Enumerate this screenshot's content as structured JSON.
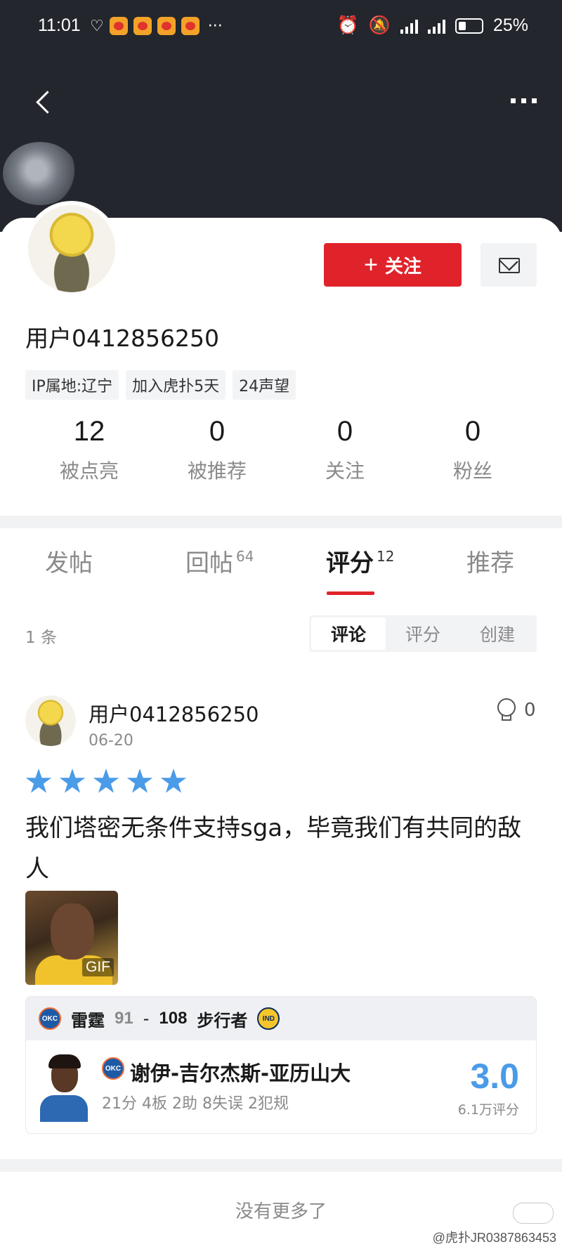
{
  "status": {
    "time": "11:01",
    "battery": "25%",
    "net1": "4G",
    "net2": "4G"
  },
  "profile": {
    "username": "用户0412856250",
    "follow_label": "关注",
    "tags": [
      "IP属地:辽宁",
      "加入虎扑5天",
      "24声望"
    ],
    "stats": [
      {
        "value": "12",
        "label": "被点亮"
      },
      {
        "value": "0",
        "label": "被推荐"
      },
      {
        "value": "0",
        "label": "关注"
      },
      {
        "value": "0",
        "label": "粉丝"
      }
    ]
  },
  "tabs": [
    {
      "label": "发帖",
      "count": ""
    },
    {
      "label": "回帖",
      "count": "64"
    },
    {
      "label": "评分",
      "count": "12",
      "active": true
    },
    {
      "label": "推荐",
      "count": ""
    }
  ],
  "list": {
    "count_text": "1 条",
    "segments": [
      "评论",
      "评分",
      "创建"
    ],
    "active_segment": "评论"
  },
  "post": {
    "username": "用户0412856250",
    "date": "06-20",
    "like_count": "0",
    "stars": 5,
    "star_color": "#4a9be8",
    "text": "我们塔密无条件支持sga，毕竟我们有共同的敌人",
    "gif_label": "GIF"
  },
  "game": {
    "team_a": {
      "name": "雷霆",
      "score": "91",
      "logo": "OKC"
    },
    "team_b": {
      "name": "步行者",
      "score": "108",
      "logo": "IND"
    },
    "dash": "-",
    "player_name": "谢伊-吉尔杰斯-亚历山大",
    "player_stats": "21分 4板 2助 8失误 2犯规",
    "rating": "3.0",
    "rating_count": "6.1万评分"
  },
  "footer": {
    "end_text": "没有更多了",
    "watermark": "@虎扑JR0387863453"
  },
  "colors": {
    "accent_red": "#e0232b",
    "rating_blue": "#4a9be8",
    "header_dark": "#23262c"
  }
}
